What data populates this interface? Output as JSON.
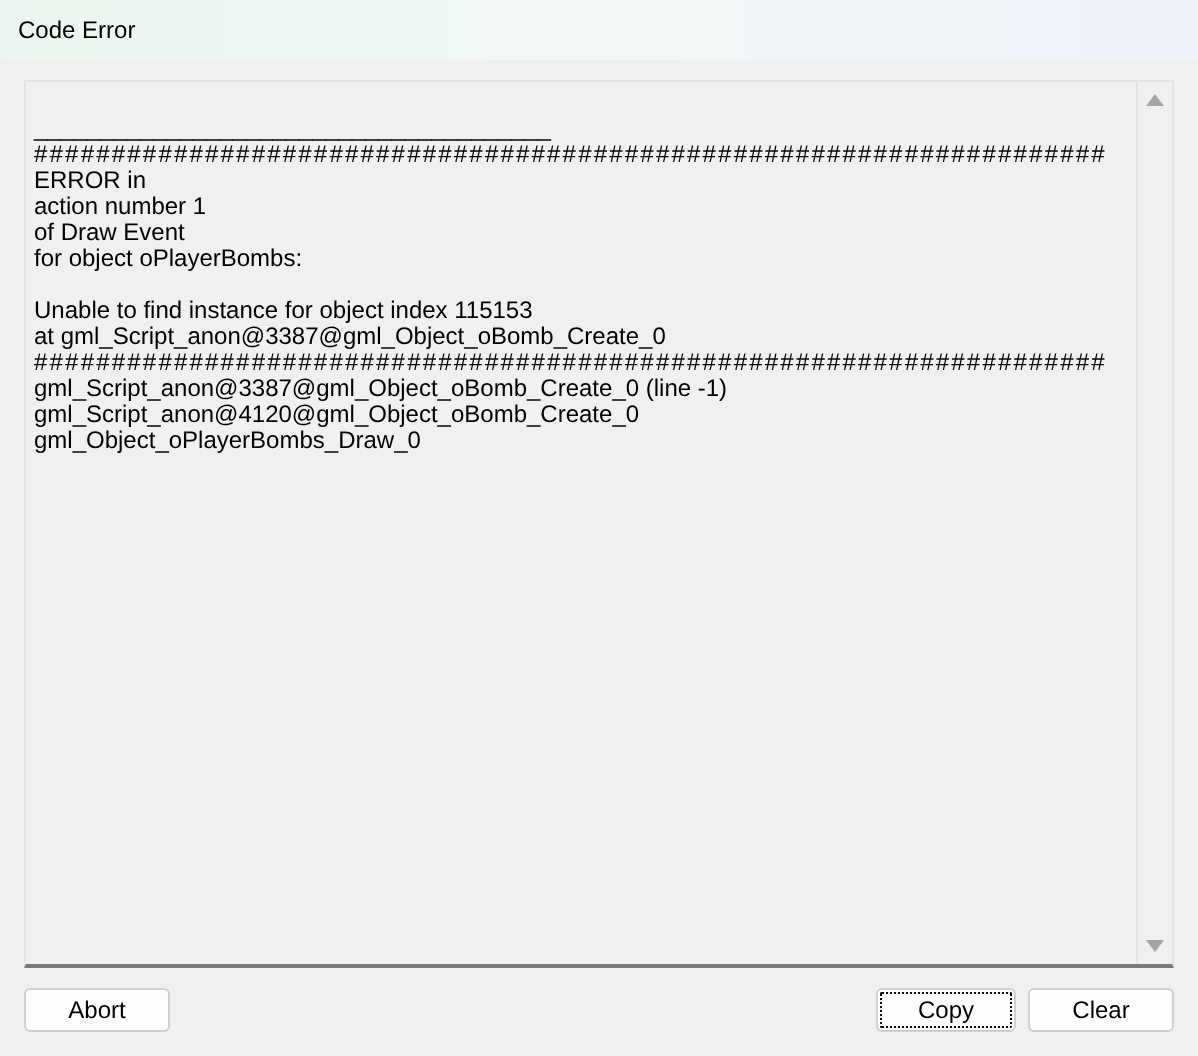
{
  "window": {
    "title": "Code Error"
  },
  "log": {
    "lines": [
      {
        "kind": "blank"
      },
      {
        "kind": "rule",
        "text": "_______________________________________"
      },
      {
        "kind": "separator",
        "text": "#####################################################################"
      },
      {
        "kind": "text",
        "text": "ERROR in"
      },
      {
        "kind": "text",
        "text": "action number 1"
      },
      {
        "kind": "text",
        "text": "of Draw Event"
      },
      {
        "kind": "text",
        "text": "for object oPlayerBombs:"
      },
      {
        "kind": "blank"
      },
      {
        "kind": "text",
        "text": "Unable to find instance for object index 115153"
      },
      {
        "kind": "text",
        "text": "at gml_Script_anon@3387@gml_Object_oBomb_Create_0"
      },
      {
        "kind": "separator",
        "text": "#####################################################################"
      },
      {
        "kind": "text",
        "text": "gml_Script_anon@3387@gml_Object_oBomb_Create_0 (line -1)"
      },
      {
        "kind": "text",
        "text": "gml_Script_anon@4120@gml_Object_oBomb_Create_0"
      },
      {
        "kind": "text",
        "text": "gml_Object_oPlayerBombs_Draw_0"
      }
    ]
  },
  "left_buttons": [
    {
      "label": "Abort",
      "focused": false
    }
  ],
  "right_buttons": [
    {
      "label": "Copy",
      "focused": true
    },
    {
      "label": "Clear",
      "focused": false
    }
  ]
}
